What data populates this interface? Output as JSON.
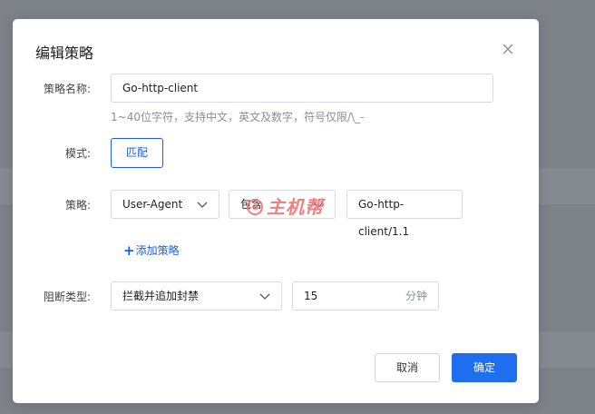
{
  "dialog": {
    "title": "编辑策略",
    "close_icon": "close-icon",
    "fields": {
      "name_label": "策略名称:",
      "name_value": "Go-http-client",
      "name_hint": "1~40位字符，支持中文，英文及数字，符号仅限/\\_-",
      "mode_label": "模式:",
      "mode_button": "匹配",
      "strategy_label": "策略:",
      "strategy_field": "User-Agent",
      "strategy_operator": "包含",
      "strategy_value": "Go-http-client/1.1",
      "add_strategy": "添加策略",
      "block_type_label": "阻断类型:",
      "block_type_value": "拦截并追加封禁",
      "duration_value": "15",
      "duration_unit": "分钟"
    },
    "buttons": {
      "cancel": "取消",
      "confirm": "确定"
    }
  },
  "watermark": {
    "text": "主机帮"
  },
  "colors": {
    "accent": "#1f6ef0",
    "overlay": "#7d8288",
    "watermark": "#f07272"
  }
}
